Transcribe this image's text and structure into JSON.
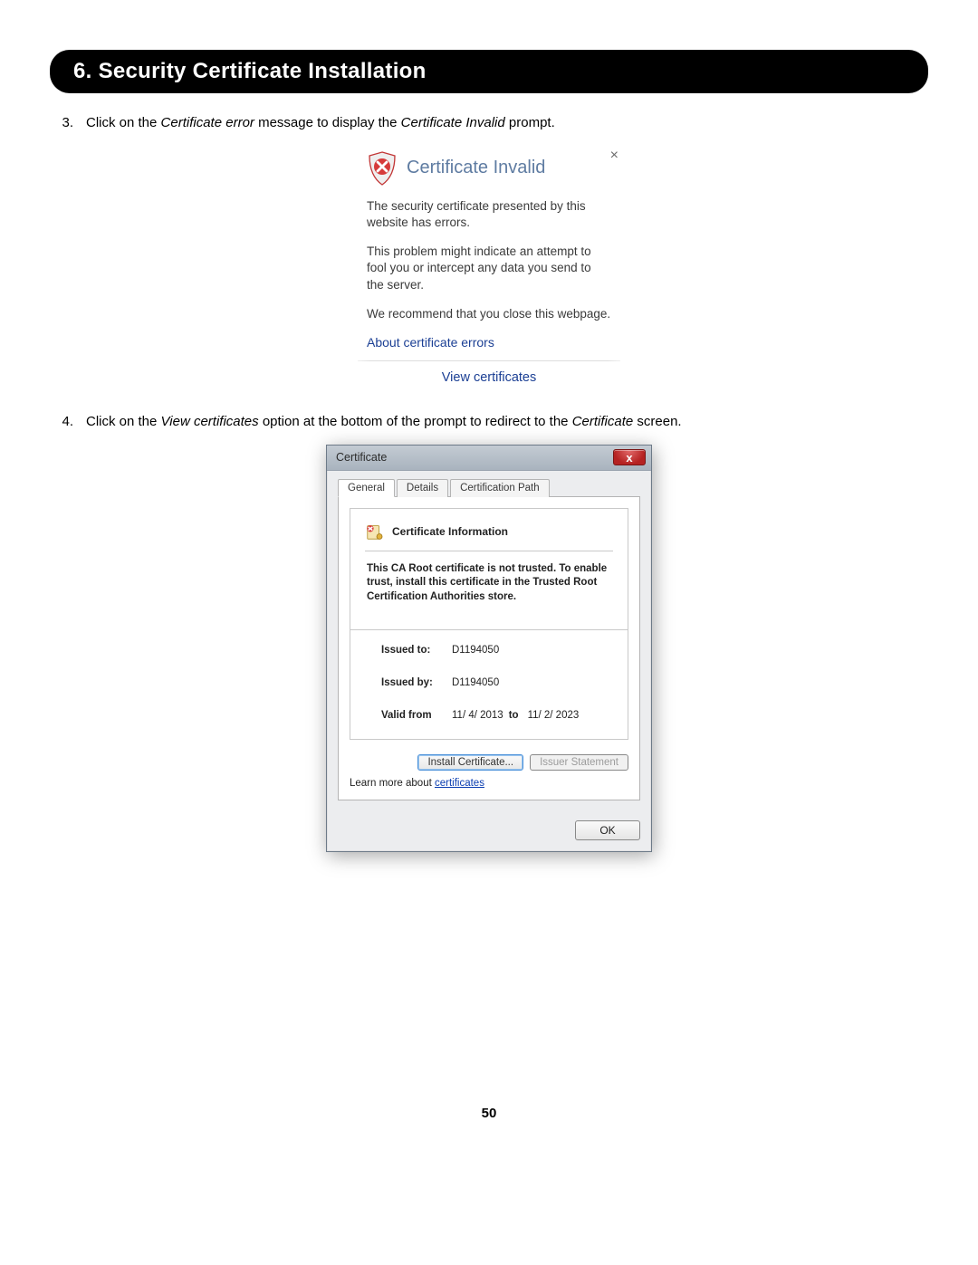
{
  "section_header": "6. Security Certificate Installation",
  "steps": [
    {
      "num": "3.",
      "before": "Click on the ",
      "em1": "Certificate error",
      "mid": " message to display the ",
      "em2": "Certificate Invalid",
      "after": " prompt."
    },
    {
      "num": "4.",
      "before": "Click on the ",
      "em1": "View certificates",
      "mid": " option at the bottom of the prompt to redirect to the ",
      "em2": "Certificate",
      "after": " screen."
    }
  ],
  "popup": {
    "close": "×",
    "title": "Certificate Invalid",
    "p1": "The security certificate presented by this website has errors.",
    "p2": "This problem might indicate an attempt to fool you or intercept any data you send to the server.",
    "p3": "We recommend that you close this webpage.",
    "about_link": "About certificate errors",
    "view_link": "View certificates"
  },
  "dialog": {
    "title": "Certificate",
    "close": "x",
    "tabs": {
      "general": "General",
      "details": "Details",
      "path": "Certification Path"
    },
    "cert_info_label": "Certificate Information",
    "warning": "This CA Root certificate is not trusted. To enable trust, install this certificate in the Trusted Root Certification Authorities store.",
    "meta": {
      "issued_to_label": "Issued to:",
      "issued_to": "D1194050",
      "issued_by_label": "Issued by:",
      "issued_by": "D1194050",
      "valid_from_label": "Valid from",
      "valid_from": "11/ 4/ 2013",
      "valid_to_label": "to",
      "valid_to": "11/ 2/ 2023"
    },
    "install_btn": "Install Certificate...",
    "issuer_btn": "Issuer Statement",
    "learn_prefix": "Learn more about ",
    "learn_link": "certificates",
    "ok": "OK"
  },
  "page_number": "50"
}
